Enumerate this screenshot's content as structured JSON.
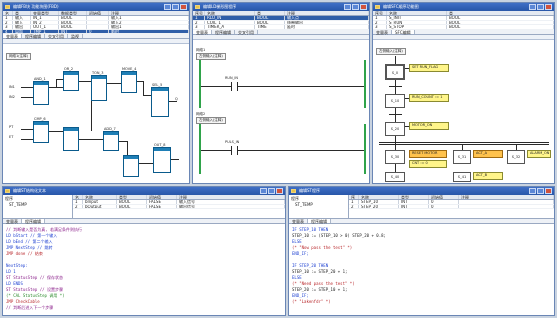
{
  "desktop_bg": "#c9d3e0",
  "win1": {
    "title": "编辑FB块 功能块图(FBD)",
    "table": {
      "headers": [
        "名",
        "类",
        "变量类型",
        "数据类型",
        "初始值",
        "注释"
      ],
      "rows": [
        [
          "1",
          "输入",
          "IN_1",
          "BOOL",
          "",
          "输入1"
        ],
        [
          "2",
          "输入",
          "IN_2",
          "BOOL",
          "",
          "输入2"
        ],
        [
          "3",
          "输出",
          "OUT_1",
          "BOOL",
          "",
          "输出1"
        ],
        [
          "4",
          "局部",
          "TMP_1",
          "INT",
          "0",
          "临时"
        ]
      ]
    },
    "tabs": [
      "变量表",
      "程序编辑",
      "交叉引用",
      "监视"
    ],
    "network_label": "网络1(注释)",
    "fb_labels": [
      "AND_1",
      "OR_2",
      "TON_3",
      "MOVE_4",
      "SEL_5",
      "CMP_6",
      "ADD_7",
      "OUT_8"
    ],
    "pin_labels": [
      "IN1",
      "IN2",
      "Q",
      "PT",
      "ET"
    ]
  },
  "win2": {
    "title": "编辑LD梯形图程序",
    "table": {
      "headers": [
        "序号",
        "名称",
        "类",
        "注释"
      ],
      "rows": [
        [
          "1",
          "RLO_IN",
          "BOOL",
          "输入点"
        ],
        [
          "2",
          "COIL_1",
          "BOOL",
          "线圈输出"
        ],
        [
          "3",
          "TIMER_A",
          "TIME",
          "延时"
        ]
      ]
    },
    "tabs": [
      "变量表",
      "程序编辑",
      "交叉引用"
    ],
    "rung1_label": "网络1",
    "rung1_title": "左侧输入(注释)",
    "rung2_label": "网络2",
    "rung2_title": "左侧输入(注释)",
    "contact1": "RUN_IN",
    "contact2": "PULS_IN"
  },
  "win3": {
    "title": "编辑SFC顺序功能图",
    "table": {
      "headers": [
        "序号",
        "名称",
        "类"
      ],
      "rows": [
        [
          "1",
          "S_INIT",
          "BOOL"
        ],
        [
          "2",
          "S_RUN",
          "BOOL"
        ],
        [
          "3",
          "S_STOP",
          "BOOL"
        ]
      ]
    },
    "tabs": [
      "变量表",
      "SFC编辑"
    ],
    "net_label": "左侧输入(注释)",
    "steps": [
      "S_0",
      "S_10",
      "S_20",
      "S_30",
      "S_31",
      "S_32",
      "S_40",
      "S_41"
    ],
    "actions": [
      "SET RUN_FLAG",
      "RUN_COUNT := 1",
      "MOTOR_ON",
      "RESET MOTOR",
      "CNT := 0",
      "ACT_A",
      "ALARM_ON",
      "ACT_B"
    ]
  },
  "win4": {
    "title": "编辑ST结构化文本",
    "tree_root": "程序",
    "tree_item": "ST_TEMP",
    "table": {
      "headers": [
        "名",
        "名称",
        "类型",
        "初始值",
        "注释"
      ],
      "rows": [
        [
          "1",
          "bInput",
          "BOOL",
          "FALSE",
          "输入信号"
        ],
        [
          "2",
          "bOutput",
          "BOOL",
          "FALSE",
          "输出信号"
        ]
      ]
    },
    "tabs": [
      "变量表",
      "程序编辑"
    ],
    "code": [
      {
        "cls": "c-pur",
        "text": "// 判断输入是否为真, 若满足条件则执行"
      },
      {
        "cls": "c-blue",
        "text": "LD  bStart      // 第一个输入"
      },
      {
        "cls": "c-blue",
        "text": "LD  bEnd        // 第二个输入"
      },
      {
        "cls": "c-blue",
        "text": "JMP NextStep    // 跳转"
      },
      {
        "cls": "c-red",
        "text": "JMP done        // 结束"
      },
      {
        "cls": "",
        "text": ""
      },
      {
        "cls": "c-blue",
        "text": "NextStep:"
      },
      {
        "cls": "c-blue",
        "text": "LD 1"
      },
      {
        "cls": "c-pur",
        "text": "  ST  StatusStep  // 保存状态"
      },
      {
        "cls": "c-blue",
        "text": "LD  ENDS"
      },
      {
        "cls": "c-pur",
        "text": "  ST  StatusStep  // 设置步骤"
      },
      {
        "cls": "c-green",
        "text": "    (* CAL StatusStep 调用 *)"
      },
      {
        "cls": "c-red",
        "text": "JMP CheckCable"
      },
      {
        "cls": "c-pur",
        "text": "// 判断后进入下一个步骤"
      }
    ]
  },
  "win5": {
    "title": "编辑ST程序",
    "tree_root": "程序",
    "tree_item": "ST_TEMP",
    "table": {
      "headers": [
        "序",
        "名称",
        "类型",
        "初始值",
        "注释"
      ],
      "rows": [
        [
          "1",
          "STEP_10",
          "INT",
          "0",
          ""
        ],
        [
          "2",
          "STEP_20",
          "INT",
          "0",
          ""
        ]
      ]
    },
    "tabs": [
      "变量表",
      "程序编辑"
    ],
    "code": [
      {
        "cls": "c-blue",
        "text": "IF  STEP_10  THEN"
      },
      {
        "cls": "",
        "text": "    STEP_10 := (STEP_10 > 0) STEP_20 + 0.8;"
      },
      {
        "cls": "c-blue",
        "text": "ELSE"
      },
      {
        "cls": "c-red",
        "text": "        (* \"Now pass the test\" *)"
      },
      {
        "cls": "c-blue",
        "text": "END_IF;"
      },
      {
        "cls": "",
        "text": ""
      },
      {
        "cls": "c-blue",
        "text": "IF  STEP_20  THEN"
      },
      {
        "cls": "",
        "text": "    STEP_10 := STEP_20 + 1;"
      },
      {
        "cls": "c-blue",
        "text": "ELSE"
      },
      {
        "cls": "c-red",
        "text": "        (* \"Need pass the test\" *)"
      },
      {
        "cls": "",
        "text": "    STEP_20 := STEP_10 + 1;"
      },
      {
        "cls": "c-blue",
        "text": "END_IF;"
      },
      {
        "cls": "c-red",
        "text": "        (* \"Lakenfdr\" *)"
      }
    ]
  }
}
